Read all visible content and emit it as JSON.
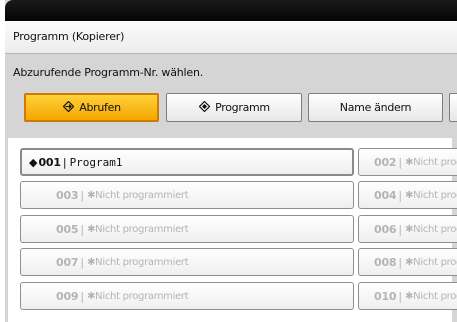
{
  "title": "Programm (Kopierer)",
  "instruction": "Abzurufende Programm-Nr. wählen.",
  "mode_buttons": [
    {
      "label": "Abrufen",
      "icon": "◆",
      "active": true
    },
    {
      "label": "Programm",
      "icon": "◆",
      "active": false
    },
    {
      "label": "Name ändern",
      "icon": "",
      "active": false
    }
  ],
  "programs": [
    {
      "number": "001",
      "name": "Program1",
      "programmed": true
    },
    {
      "number": "002",
      "name": "✱Nicht programmiert",
      "programmed": false
    },
    {
      "number": "003",
      "name": "✱Nicht programmiert",
      "programmed": false
    },
    {
      "number": "004",
      "name": "✱Nicht programmiert",
      "programmed": false
    },
    {
      "number": "005",
      "name": "✱Nicht programmiert",
      "programmed": false
    },
    {
      "number": "006",
      "name": "✱Nicht programmiert",
      "programmed": false
    },
    {
      "number": "007",
      "name": "✱Nicht programmiert",
      "programmed": false
    },
    {
      "number": "008",
      "name": "✱Nicht programmiert",
      "programmed": false
    },
    {
      "number": "009",
      "name": "✱Nicht programmiert",
      "programmed": false
    },
    {
      "number": "010",
      "name": "✱Nicht programmiert",
      "programmed": false
    }
  ],
  "colors": {
    "active_button": "#f7b500",
    "panel_background": "#d5d5d5",
    "unprogrammed_text": "#b4b4b4"
  }
}
